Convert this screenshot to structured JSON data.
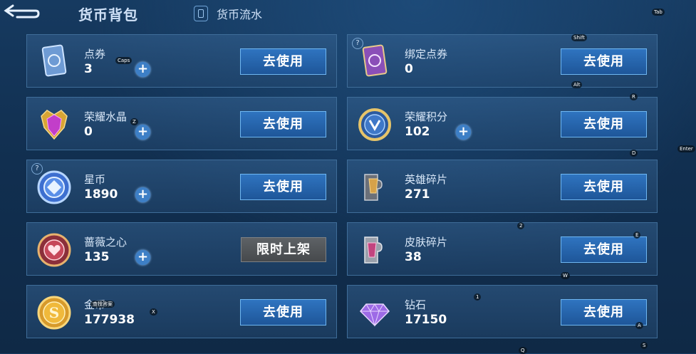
{
  "header": {
    "title": "货币背包",
    "flow_label": "货币流水"
  },
  "use_label": "去使用",
  "limited_label": "限时上架",
  "plus_label": "+",
  "question_mark": "?",
  "cards": [
    {
      "name": "点券",
      "value": "3",
      "icon": "coupon-card-icon"
    },
    {
      "name": "绑定点券",
      "value": "0",
      "icon": "bound-coupon-card-icon"
    },
    {
      "name": "荣耀水晶",
      "value": "0",
      "icon": "glory-crystal-icon"
    },
    {
      "name": "荣耀积分",
      "value": "102",
      "icon": "glory-points-icon"
    },
    {
      "name": "星币",
      "value": "1890",
      "icon": "star-coin-icon"
    },
    {
      "name": "英雄碎片",
      "value": "271",
      "icon": "hero-fragment-icon"
    },
    {
      "name": "蔷薇之心",
      "value": "135",
      "icon": "rose-heart-icon"
    },
    {
      "name": "皮肤碎片",
      "value": "38",
      "icon": "skin-fragment-icon"
    },
    {
      "name": "金币",
      "value": "177938",
      "icon": "gold-coin-icon"
    },
    {
      "name": "钻石",
      "value": "17150",
      "icon": "diamond-icon"
    }
  ],
  "key_overlays": [
    "Caps",
    "Shift",
    "Alt",
    "R",
    "Z",
    "D",
    "Enter",
    "2",
    "E",
    "W",
    "1",
    "A",
    "S",
    "Q",
    "X",
    "Tab",
    "查找答案"
  ]
}
